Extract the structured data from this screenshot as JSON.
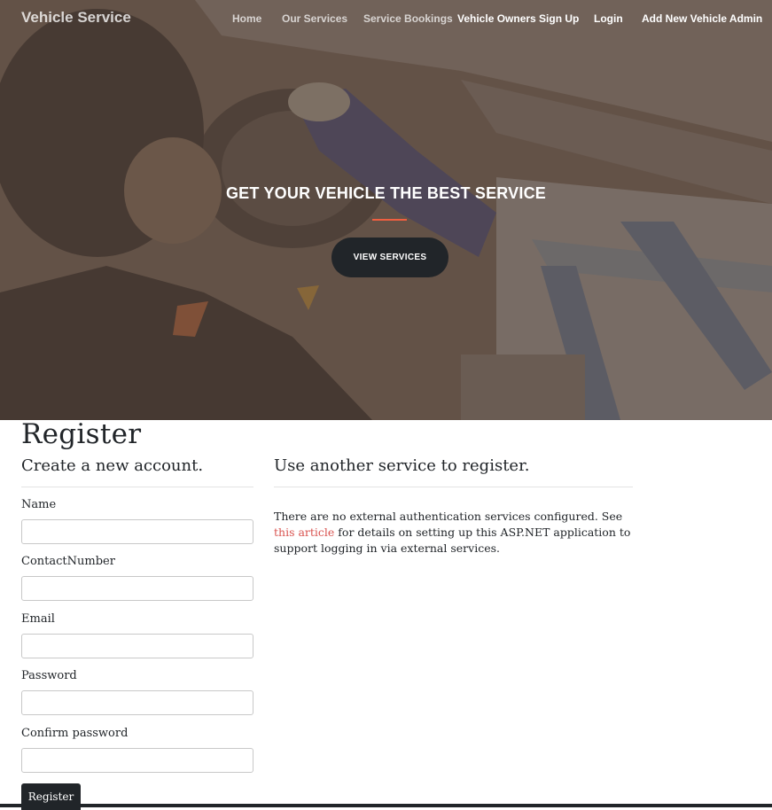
{
  "navbar": {
    "brand": "Vehicle Service",
    "links": [
      {
        "label": "Home"
      },
      {
        "label": "Our Services"
      },
      {
        "label": "Service Bookings"
      },
      {
        "label": "Vehicle Owners Sign Up"
      },
      {
        "label": "Login"
      },
      {
        "label": "Add New Vehicle Admin"
      }
    ]
  },
  "hero": {
    "title": "GET YOUR VEHICLE THE BEST SERVICE",
    "button_label": "VIEW SERVICES",
    "accent_color": "#f05f40"
  },
  "register": {
    "title": "Register",
    "subtitle": "Create a new account.",
    "fields": [
      {
        "label": "Name",
        "value": ""
      },
      {
        "label": "ContactNumber",
        "value": ""
      },
      {
        "label": "Email",
        "value": ""
      },
      {
        "label": "Password",
        "value": ""
      },
      {
        "label": "Confirm password",
        "value": ""
      }
    ],
    "submit_label": "Register"
  },
  "external": {
    "heading": "Use another service to register.",
    "text_before": "There are no external authentication services configured. See ",
    "link_text": "this article",
    "text_after": " for details on setting up this ASP.NET application to support logging in via external services."
  }
}
